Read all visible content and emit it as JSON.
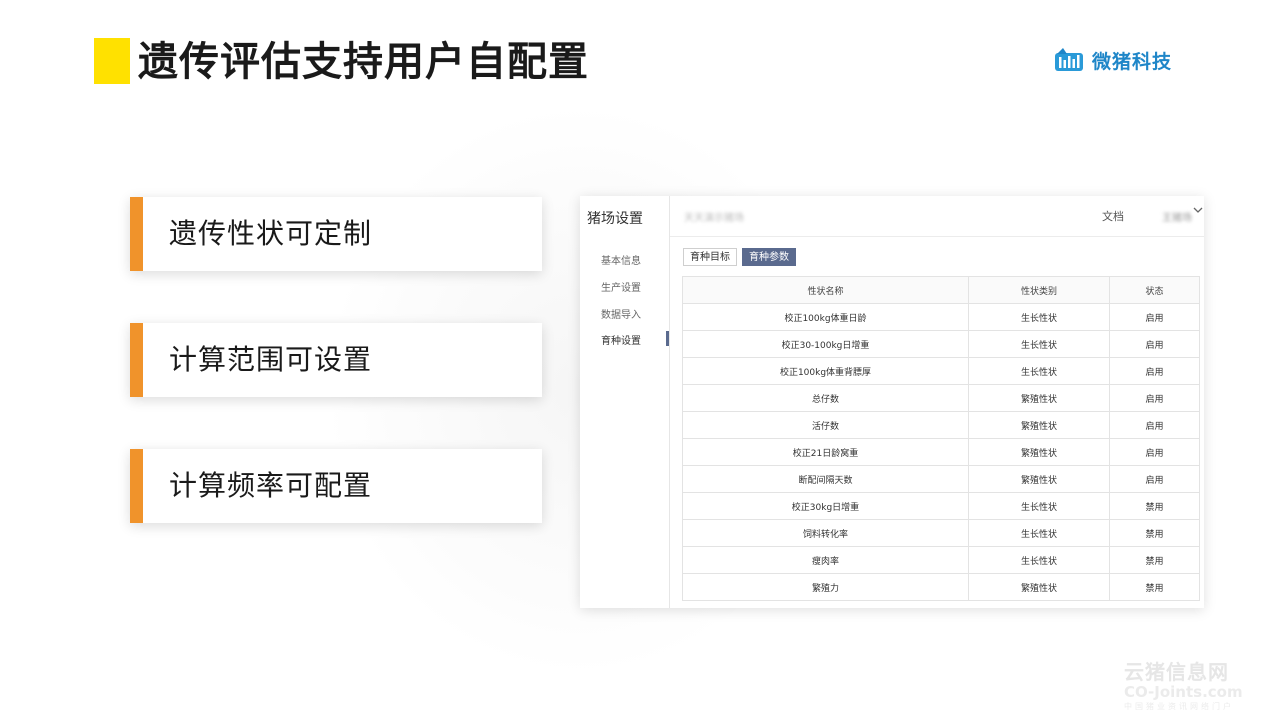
{
  "slide": {
    "title": "遗传评估支持用户自配置",
    "accent_color": "#FFE100",
    "card_accent_color": "#F0932B"
  },
  "logo": {
    "text": "微猪科技",
    "icon": "bar-chart-logo-icon",
    "color": "#1f86c8"
  },
  "features": [
    {
      "label": "遗传性状可定制"
    },
    {
      "label": "计算范围可设置"
    },
    {
      "label": "计算频率可配置"
    }
  ],
  "app": {
    "sidebar": {
      "title": "猪场设置",
      "items": [
        {
          "label": "基本信息"
        },
        {
          "label": "生产设置"
        },
        {
          "label": "数据导入"
        },
        {
          "label": "育种设置"
        }
      ],
      "active_index": 3
    },
    "topbar": {
      "farm_name": "天天演示猪场",
      "doc_label": "文档",
      "user_name": "王猪场",
      "chevron_icon": "chevron-down-icon"
    },
    "tabs": [
      {
        "label": "育种目标",
        "active": false
      },
      {
        "label": "育种参数",
        "active": true
      }
    ],
    "table": {
      "headers": [
        "性状名称",
        "性状类别",
        "状态"
      ],
      "rows": [
        [
          "校正100kg体重日龄",
          "生长性状",
          "启用"
        ],
        [
          "校正30-100kg日增重",
          "生长性状",
          "启用"
        ],
        [
          "校正100kg体重背膘厚",
          "生长性状",
          "启用"
        ],
        [
          "总仔数",
          "繁殖性状",
          "启用"
        ],
        [
          "活仔数",
          "繁殖性状",
          "启用"
        ],
        [
          "校正21日龄窝重",
          "繁殖性状",
          "启用"
        ],
        [
          "断配间隔天数",
          "繁殖性状",
          "启用"
        ],
        [
          "校正30kg日增重",
          "生长性状",
          "禁用"
        ],
        [
          "饲料转化率",
          "生长性状",
          "禁用"
        ],
        [
          "瘦肉率",
          "生长性状",
          "禁用"
        ],
        [
          "繁殖力",
          "繁殖性状",
          "禁用"
        ]
      ]
    }
  },
  "watermark": {
    "cn": "云猪信息网",
    "en": "CO-Joints.com",
    "sub": "中国猪业资讯网络门户"
  }
}
